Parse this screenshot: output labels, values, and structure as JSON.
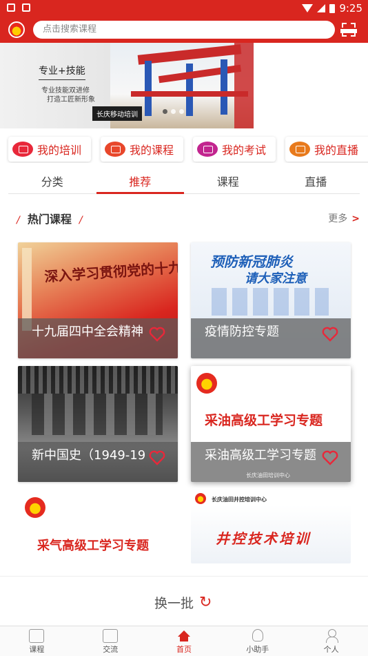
{
  "status_bar": {
    "time": "9:25"
  },
  "search": {
    "placeholder": "点击搜索课程"
  },
  "banner": {
    "title": "专业+技能",
    "subtitle_line1": "专业技能双进修",
    "subtitle_line2": "打造工匠新形象",
    "tag": "长庆移动培训"
  },
  "shortcuts": [
    {
      "label": "我的培训",
      "icon": "training-icon",
      "color": "#e8283a"
    },
    {
      "label": "我的课程",
      "icon": "course-icon",
      "color": "#e8472b"
    },
    {
      "label": "我的考试",
      "icon": "exam-icon",
      "color": "#c2258f"
    },
    {
      "label": "我的直播",
      "icon": "live-icon",
      "color": "#e87a1c"
    }
  ],
  "tabs": [
    "分类",
    "推荐",
    "课程",
    "直播"
  ],
  "active_tab": "推荐",
  "section": {
    "title": "热门课程",
    "more": "更多"
  },
  "courses": [
    {
      "caption": "十九届四中全会精神",
      "banner_text": "深入学习贯彻党的十九届四中全会精神"
    },
    {
      "caption": "疫情防控专题",
      "banner_text_1": "预防新冠肺炎",
      "banner_text_2": "请大家注意"
    },
    {
      "caption": "新中国史（1949-19"
    },
    {
      "caption": "采油高级工学习专题",
      "banner_text": "采油高级工学习专题",
      "footer": "长庆油田培训中心"
    },
    {
      "banner_text": "采气高级工学习专题"
    },
    {
      "banner_text": "井控技术培训",
      "header_text": "长庆油田井控培训中心"
    }
  ],
  "refresh": {
    "label": "换一批"
  },
  "bottom_nav": [
    {
      "label": "课程",
      "icon": "book-icon"
    },
    {
      "label": "交流",
      "icon": "chat-icon"
    },
    {
      "label": "首页",
      "icon": "home-icon"
    },
    {
      "label": "小助手",
      "icon": "bulb-icon"
    },
    {
      "label": "个人",
      "icon": "user-icon"
    }
  ],
  "colors": {
    "brand": "#d9261f",
    "heart": "#e8283a"
  }
}
